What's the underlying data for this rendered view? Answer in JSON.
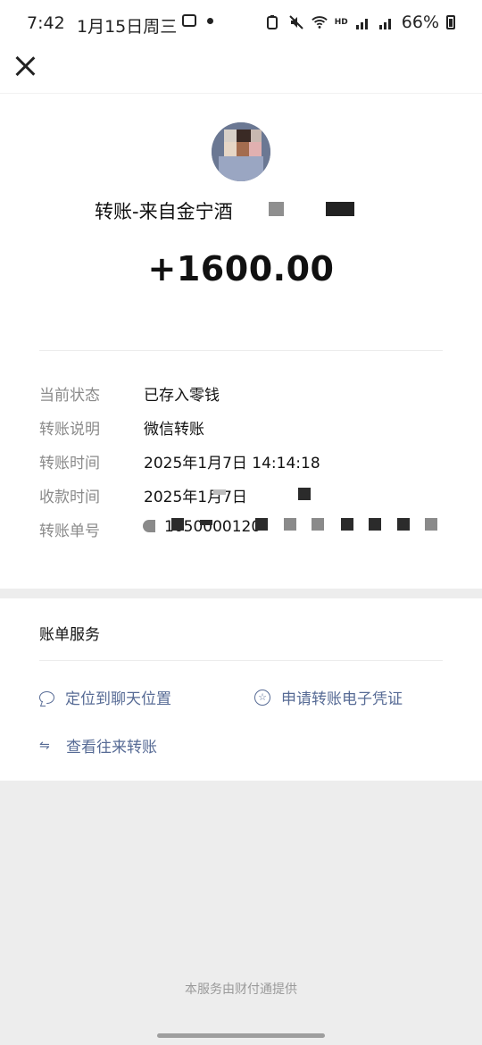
{
  "status_bar": {
    "time": "7:42",
    "date": "1月15日周三",
    "battery": "66%",
    "network_label": "HD"
  },
  "transfer": {
    "title": "转账-来自金宁酒",
    "amount": "+1600.00"
  },
  "details": [
    {
      "label": "当前状态",
      "value": "已存入零钱"
    },
    {
      "label": "转账说明",
      "value": "微信转账"
    },
    {
      "label": "转账时间",
      "value": "2025年1月7日 14:14:18"
    },
    {
      "label": "收款时间",
      "value": "2025年1月7日"
    },
    {
      "label": "转账单号",
      "value": "1050000120"
    }
  ],
  "services": {
    "title": "账单服务",
    "locate_chat": "定位到聊天位置",
    "apply_receipt": "申请转账电子凭证",
    "view_transfers": "查看往来转账"
  },
  "footer": "本服务由财付通提供",
  "colors": {
    "link": "#576b95",
    "label_gray": "#8a8a8a",
    "page_bg": "#ededed"
  }
}
